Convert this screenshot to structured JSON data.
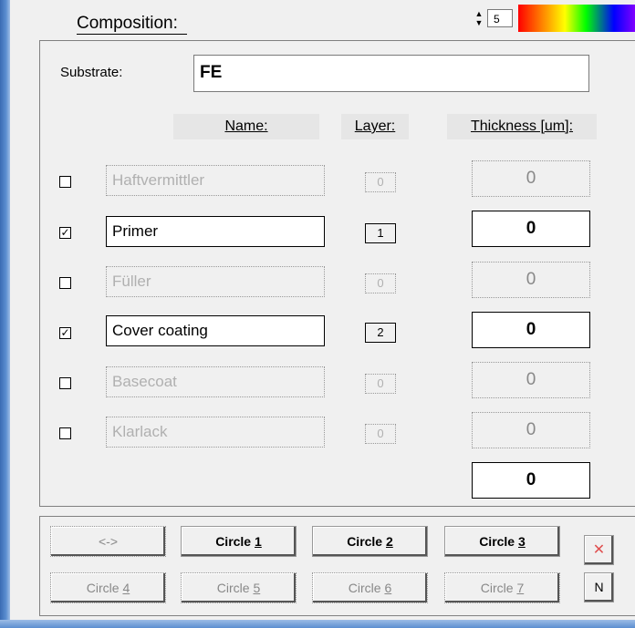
{
  "composition": {
    "title": "Composition:",
    "spin_value": "5",
    "substrate_label": "Substrate:",
    "substrate_value": "FE"
  },
  "columns": {
    "name": "Name:",
    "layer": "Layer:",
    "thickness": "Thickness [um]:"
  },
  "rows": [
    {
      "checked": false,
      "checkmark": "",
      "name": "Haftvermittler",
      "layer": "0",
      "thickness": "0"
    },
    {
      "checked": true,
      "checkmark": "✓",
      "name": "Primer",
      "layer": "1",
      "thickness": "0"
    },
    {
      "checked": false,
      "checkmark": "",
      "name": "Füller",
      "layer": "0",
      "thickness": "0"
    },
    {
      "checked": true,
      "checkmark": "✓",
      "name": "Cover coating",
      "layer": "2",
      "thickness": "0"
    },
    {
      "checked": false,
      "checkmark": "",
      "name": "Basecoat",
      "layer": "0",
      "thickness": "0"
    },
    {
      "checked": false,
      "checkmark": "",
      "name": "Klarlack",
      "layer": "0",
      "thickness": "0"
    }
  ],
  "total_thickness": "0",
  "buttons": {
    "swap": "<->",
    "circle1_prefix": "Circle ",
    "circle1_num": "1",
    "circle2_prefix": "Circle ",
    "circle2_num": "2",
    "circle3_prefix": "Circle ",
    "circle3_num": "3",
    "circle4_prefix": "Circle ",
    "circle4_num": "4",
    "circle5_prefix": "Circle ",
    "circle5_num": "5",
    "circle6_prefix": "Circle ",
    "circle6_num": "6",
    "circle7_prefix": "Circle ",
    "circle7_num": "7",
    "delete": "✕",
    "new": "N"
  }
}
